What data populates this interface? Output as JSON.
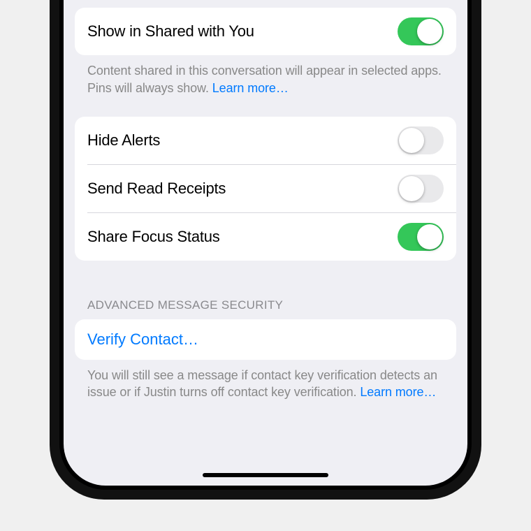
{
  "section1": {
    "rows": [
      {
        "label": "Show in Shared with You",
        "on": true
      }
    ],
    "footer": "Content shared in this conversation will appear in selected apps. Pins will always show. ",
    "footerLink": "Learn more…"
  },
  "section2": {
    "rows": [
      {
        "label": "Hide Alerts",
        "on": false
      },
      {
        "label": "Send Read Receipts",
        "on": false
      },
      {
        "label": "Share Focus Status",
        "on": true
      }
    ]
  },
  "section3": {
    "header": "ADVANCED MESSAGE SECURITY",
    "action": "Verify Contact…",
    "footer": "You will still see a message if contact key verification detects an issue or if Justin turns off contact key verification. ",
    "footerLink": "Learn more…"
  }
}
